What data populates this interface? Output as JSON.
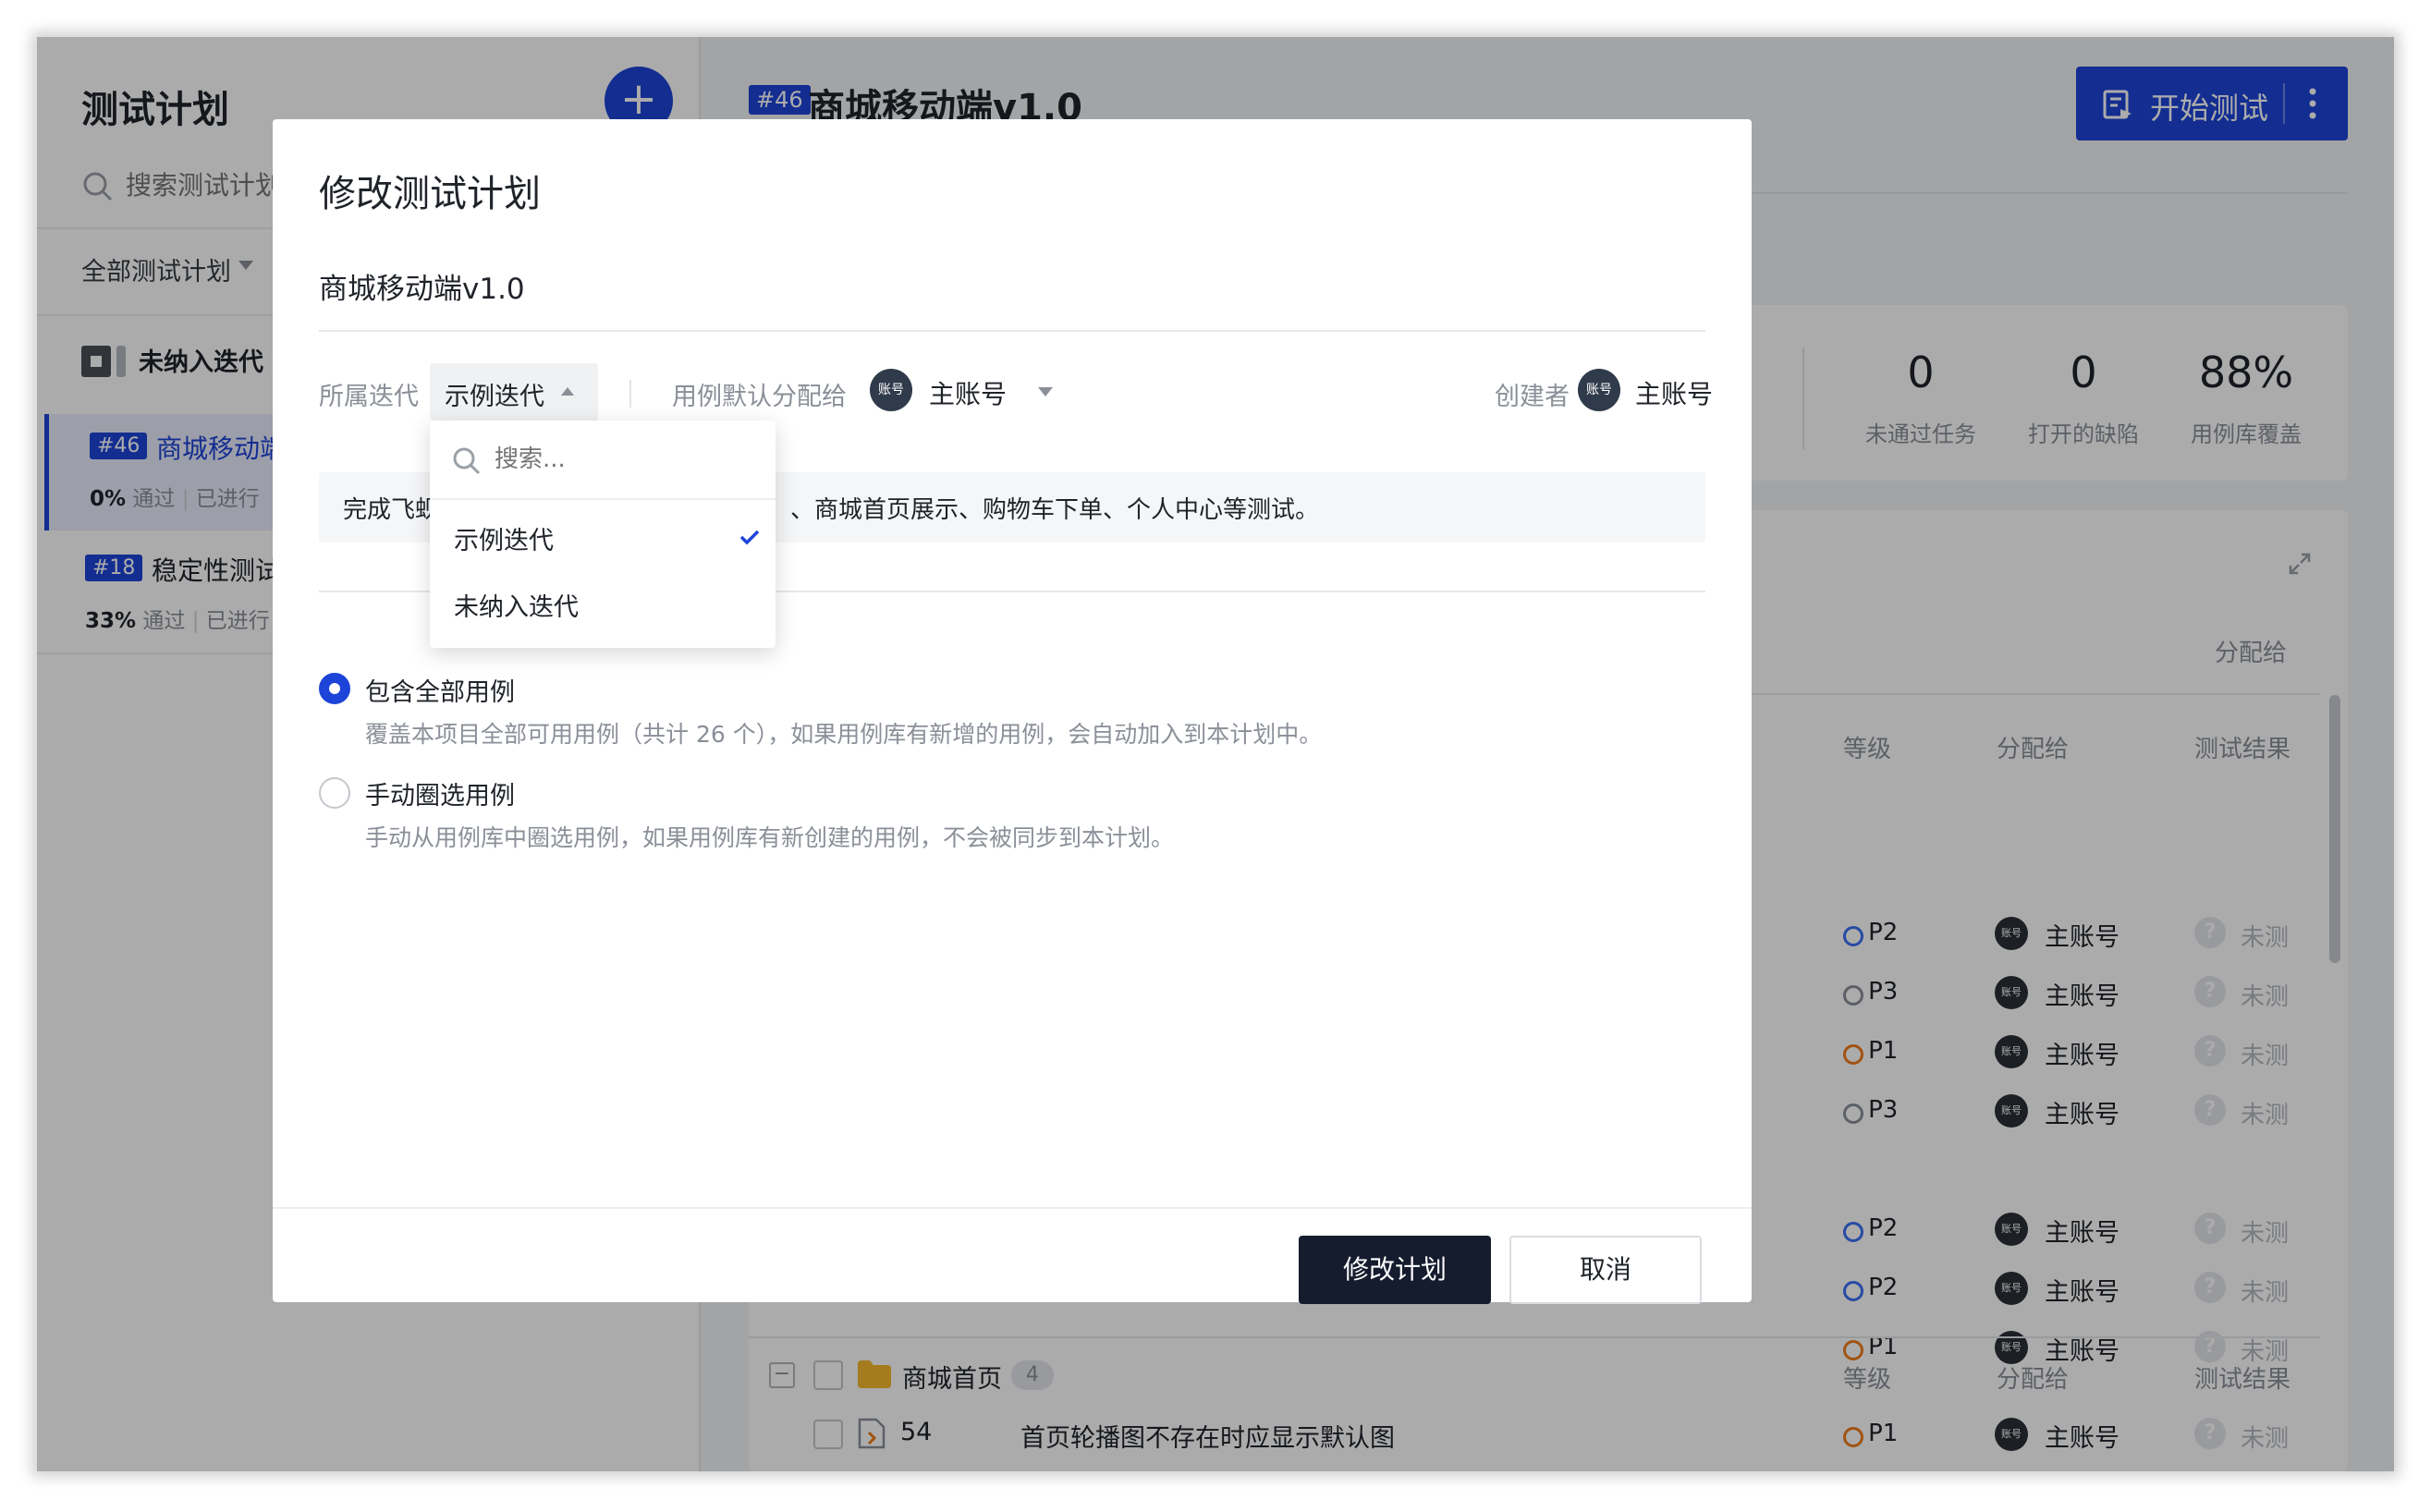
{
  "sidebar": {
    "title": "测试计划",
    "search_placeholder": "搜索测试计划",
    "filter_label": "全部测试计划",
    "group_label": "未纳入迭代",
    "plans": [
      {
        "id": "#46",
        "name": "商城移动端",
        "pass_pct": "0%",
        "pass_label": "通过",
        "progress_label": "已进行"
      },
      {
        "id": "#18",
        "name": "稳定性测试",
        "pass_pct": "33%",
        "pass_label": "通过",
        "progress_label": "已进行"
      }
    ]
  },
  "main": {
    "plan_id": "#46",
    "title": "商城移动端v1.0",
    "start_button": "开始测试",
    "stats": [
      {
        "value": "0",
        "label": "未通过任务"
      },
      {
        "value": "0",
        "label": "打开的缺陷"
      },
      {
        "value": "88%",
        "label": "用例库覆盖"
      }
    ],
    "toolbar_assign": "分配给",
    "columns": {
      "level": "等级",
      "assignee": "分配给",
      "result": "测试结果"
    },
    "rows": [
      {
        "level": "P2",
        "color": "#3b6ff5",
        "assignee": "主账号",
        "result": "未测"
      },
      {
        "level": "P3",
        "color": "#8a8f98",
        "assignee": "主账号",
        "result": "未测"
      },
      {
        "level": "P1",
        "color": "#f07c1c",
        "assignee": "主账号",
        "result": "未测"
      },
      {
        "level": "P3",
        "color": "#8a8f98",
        "assignee": "主账号",
        "result": "未测"
      },
      {
        "level": "P2",
        "color": "#3b6ff5",
        "assignee": "主账号",
        "result": "未测"
      },
      {
        "level": "P2",
        "color": "#3b6ff5",
        "assignee": "主账号",
        "result": "未测"
      },
      {
        "level": "P1",
        "color": "#f07c1c",
        "assignee": "主账号",
        "result": "未测"
      }
    ],
    "folder": {
      "name": "商城首页",
      "count": "4"
    },
    "folder_row": {
      "number": "54",
      "title": "首页轮播图不存在时应显示默认图",
      "level": "P1",
      "color": "#f07c1c",
      "assignee": "主账号",
      "result": "未测"
    }
  },
  "modal": {
    "title": "修改测试计划",
    "plan_name": "商城移动端v1.0",
    "iteration_label": "所属迭代",
    "iteration_value": "示例迭代",
    "default_assign_label": "用例默认分配给",
    "default_assignee": "主账号",
    "creator_label": "创建者",
    "creator": "主账号",
    "avatar_text": "账号",
    "description_pre": "完成飞蚬",
    "description_post": "、商城首页展示、购物车下单、个人中心等测试。",
    "options": [
      {
        "title": "包含全部用例",
        "desc": "覆盖本项目全部可用用例（共计 26 个），如果用例库有新增的用例，会自动加入到本计划中。",
        "selected": true
      },
      {
        "title": "手动圈选用例",
        "desc": "手动从用例库中圈选用例，如果用例库有新创建的用例，不会被同步到本计划。",
        "selected": false
      }
    ],
    "confirm_button": "修改计划",
    "cancel_button": "取消"
  },
  "dropdown": {
    "search_placeholder": "搜索...",
    "items": [
      {
        "label": "示例迭代",
        "selected": true
      },
      {
        "label": "未纳入迭代",
        "selected": false
      }
    ]
  },
  "colors": {
    "brand": "#1d44d8",
    "primary_dark": "#141c2e"
  }
}
